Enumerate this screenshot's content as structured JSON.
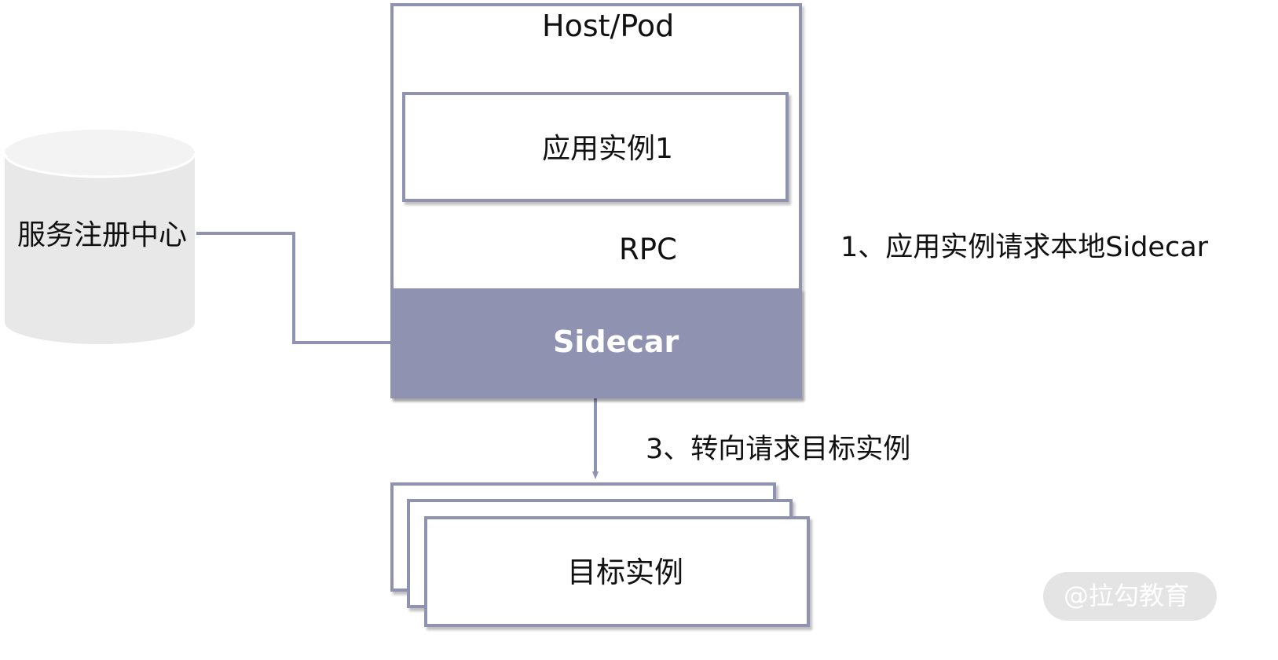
{
  "diagram": {
    "registry": {
      "label": "服务注册中心"
    },
    "host": {
      "label": "Host/Pod"
    },
    "app_instance": {
      "label": "应用实例1"
    },
    "rpc": {
      "label": "RPC"
    },
    "sidecar": {
      "label": "Sidecar"
    },
    "step1": {
      "label": "1、应用实例请求本地Sidecar"
    },
    "step3": {
      "label": "3、转向请求目标实例"
    },
    "target": {
      "label": "目标实例"
    },
    "watermark": {
      "label": "@拉勾教育"
    }
  },
  "colors": {
    "border": "#8f93b1",
    "sidecar_fill": "#8f93b1",
    "cylinder_fill": "#e8e8e8",
    "cylinder_top": "#f2f2f2",
    "text": "#111111",
    "sidecar_text": "#ffffff"
  }
}
